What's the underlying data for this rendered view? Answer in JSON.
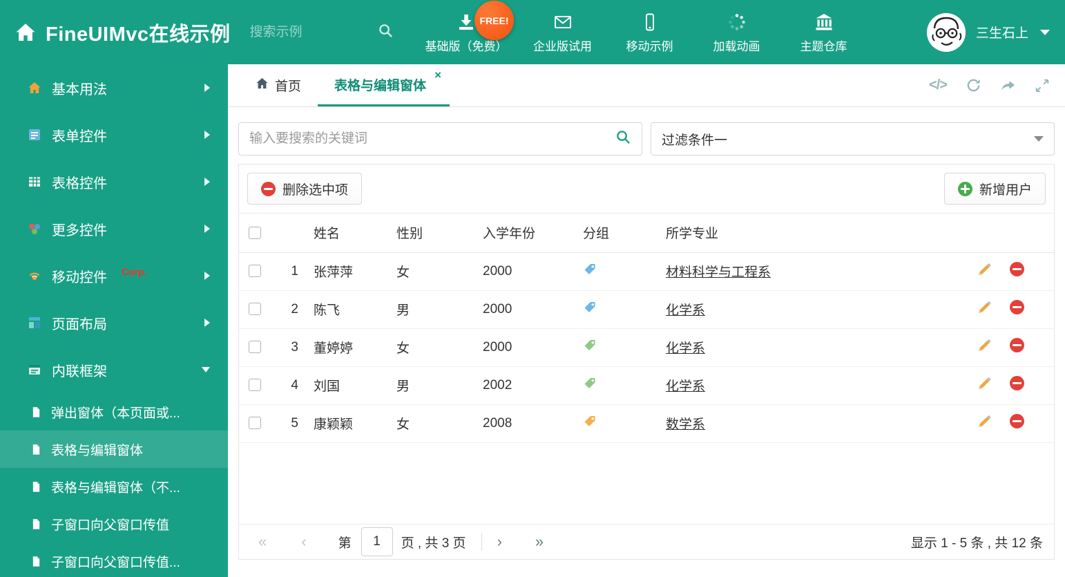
{
  "theme": {
    "teal": "#18a086",
    "teal_dark": "#0f8d77",
    "badge_orange": "#f4510e",
    "delete_red": "#e3403a",
    "add_green": "#46ac4b",
    "pencil_orange": "#f0a63e",
    "tag_blue": "#6ab8e8",
    "tag_green": "#8fca85",
    "tag_orange": "#f5b04c"
  },
  "header": {
    "title": "FineUIMvc在线示例",
    "search_placeholder": "搜索示例",
    "free_badge": "FREE!",
    "nav": [
      {
        "label": "基础版（免费）",
        "icon": "download-icon"
      },
      {
        "label": "企业版试用",
        "icon": "envelope-icon"
      },
      {
        "label": "移动示例",
        "icon": "mobile-icon"
      },
      {
        "label": "加载动画",
        "icon": "spinner-icon"
      },
      {
        "label": "主题仓库",
        "icon": "bank-icon"
      }
    ],
    "user_name": "三生石上"
  },
  "sidebar": {
    "items": [
      {
        "label": "基本用法",
        "icon": "home-icon"
      },
      {
        "label": "表单控件",
        "icon": "form-icon"
      },
      {
        "label": "表格控件",
        "icon": "table-icon"
      },
      {
        "label": "更多控件",
        "icon": "more-controls-icon"
      },
      {
        "label": "移动控件",
        "badge": "Corp.",
        "icon": "mobile-controls-icon"
      },
      {
        "label": "页面布局",
        "icon": "layout-icon"
      },
      {
        "label": "内联框架",
        "icon": "frame-icon",
        "expanded": true
      }
    ],
    "subitems": [
      {
        "label": "弹出窗体（本页面或...",
        "active": false
      },
      {
        "label": "表格与编辑窗体",
        "active": true
      },
      {
        "label": "表格与编辑窗体（不...",
        "active": false
      },
      {
        "label": "子窗口向父窗口传值",
        "active": false
      },
      {
        "label": "子窗口向父窗口传值...",
        "active": false
      }
    ]
  },
  "tabs": {
    "items": [
      {
        "label": "首页",
        "active": false
      },
      {
        "label": "表格与编辑窗体",
        "active": true
      }
    ],
    "close_label": "×"
  },
  "filter": {
    "search_placeholder": "输入要搜索的关键词",
    "dropdown_value": "过滤条件一"
  },
  "toolbar": {
    "delete_label": "删除选中项",
    "add_label": "新增用户"
  },
  "table": {
    "columns": [
      "姓名",
      "性别",
      "入学年份",
      "分组",
      "所学专业"
    ],
    "rows": [
      {
        "index": "1",
        "name": "张萍萍",
        "gender": "女",
        "year": "2000",
        "tag": "blue",
        "major": "材料科学与工程系",
        "checked": false
      },
      {
        "index": "2",
        "name": "陈飞",
        "gender": "男",
        "year": "2000",
        "tag": "blue",
        "major": "化学系",
        "checked": false
      },
      {
        "index": "3",
        "name": "董婷婷",
        "gender": "女",
        "year": "2000",
        "tag": "green",
        "major": "化学系",
        "checked": false
      },
      {
        "index": "4",
        "name": "刘国",
        "gender": "男",
        "year": "2002",
        "tag": "green",
        "major": "化学系",
        "checked": false
      },
      {
        "index": "5",
        "name": "康颖颖",
        "gender": "女",
        "year": "2008",
        "tag": "orange",
        "major": "数学系",
        "checked": false
      }
    ]
  },
  "pagination": {
    "first": "«",
    "prev": "‹",
    "next": "›",
    "last": "»",
    "label_page": "第",
    "current_page": "1",
    "label_total": "页 , 共 3 页",
    "summary": "显示 1 - 5 条 , 共 12 条"
  }
}
